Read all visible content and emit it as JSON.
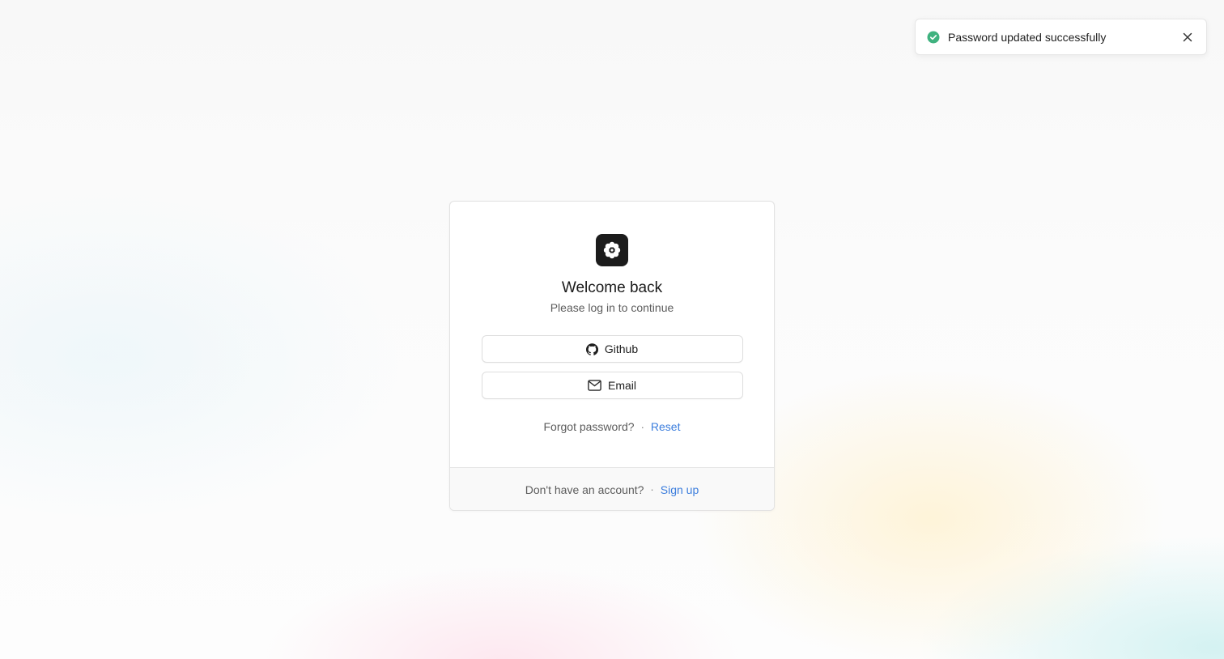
{
  "toast": {
    "message": "Password updated successfully",
    "status_icon": "check-circle-icon",
    "close_icon": "close-icon",
    "success_color": "#3fb27f"
  },
  "login": {
    "logo_icon": "flower-logo-icon",
    "title": "Welcome back",
    "subtitle": "Please log in to continue",
    "github_label": "Github",
    "github_icon": "github-icon",
    "email_label": "Email",
    "email_icon": "mail-icon",
    "forgot_text": "Forgot password?",
    "separator": "·",
    "reset_link": "Reset",
    "no_account_text": "Don't have an account?",
    "signup_link": "Sign up",
    "link_color": "#3b7ddd"
  }
}
